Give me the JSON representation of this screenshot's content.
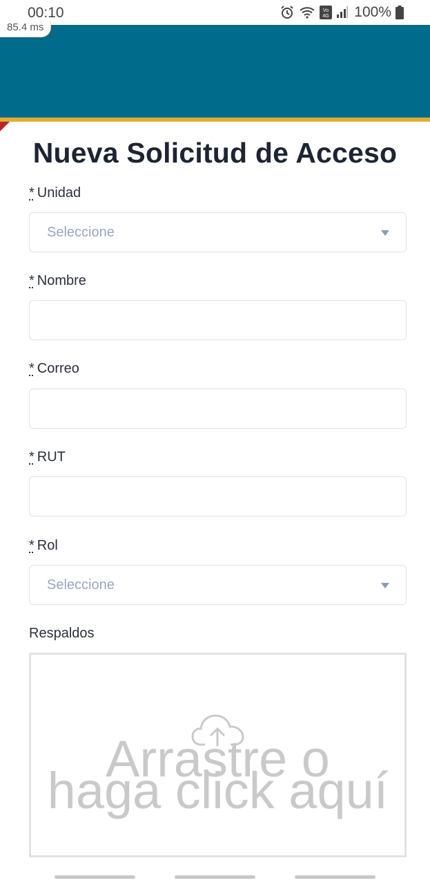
{
  "status_bar": {
    "time": "00:10",
    "battery": "100%",
    "icons": [
      "alarm-icon",
      "wifi-icon",
      "volte-4g-icon",
      "signal-icon",
      "battery-icon"
    ]
  },
  "overlay": {
    "latency": "85.4 ms"
  },
  "colors": {
    "header": "#016b8b",
    "accent_stripe": "#e3ac2e",
    "title": "#1d2433"
  },
  "form": {
    "title": "Nueva Solicitud de Acceso",
    "required_mark": "*",
    "fields": {
      "unidad": {
        "label": "Unidad",
        "placeholder": "Seleccione"
      },
      "nombre": {
        "label": "Nombre",
        "value": ""
      },
      "correo": {
        "label": "Correo",
        "value": ""
      },
      "rut": {
        "label": "RUT",
        "value": ""
      },
      "rol": {
        "label": "Rol",
        "placeholder": "Seleccione"
      }
    },
    "respaldos": {
      "label": "Respaldos",
      "dropzone_text": "Arrastre o\nhaga click aquí"
    }
  }
}
